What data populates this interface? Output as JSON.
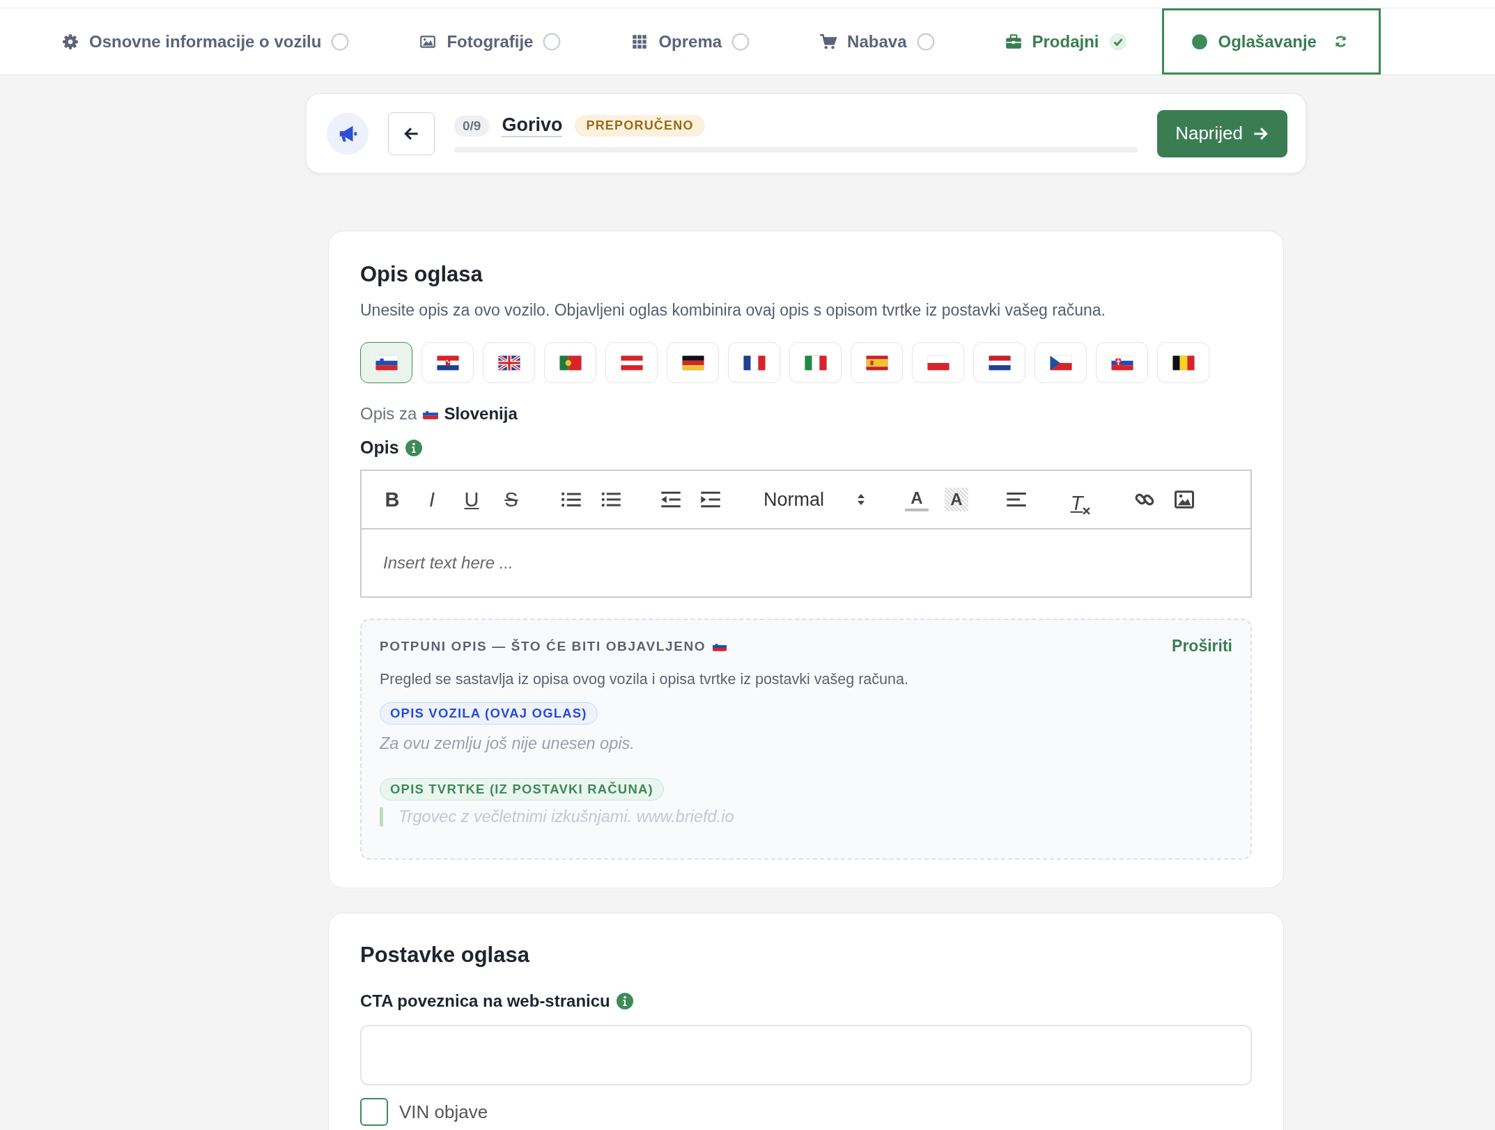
{
  "tabs": [
    {
      "label": "Osnovne informacije o vozilu",
      "done": false,
      "in_progress": false,
      "selected": false
    },
    {
      "label": "Fotografije",
      "done": false,
      "in_progress": false,
      "selected": false
    },
    {
      "label": "Oprema",
      "done": false,
      "in_progress": false,
      "selected": false
    },
    {
      "label": "Nabava",
      "done": false,
      "in_progress": false,
      "selected": false
    },
    {
      "label": "Prodajni",
      "done": true,
      "in_progress": false,
      "selected": false
    },
    {
      "label": "Oglašavanje",
      "done": false,
      "in_progress": true,
      "selected": true
    }
  ],
  "step": {
    "counter": "0/9",
    "title": "Gorivo",
    "badge": "PREPORUČENO",
    "progress": {
      "level": 0
    },
    "next_button": "Naprijed"
  },
  "description_card": {
    "title": "Opis oglasa",
    "subtitle": "Unesite opis za ovo vozilo. Objavljeni oglas kombinira ovaj opis s opisom tvrtke iz postavki vašeg računa.",
    "languages": [
      {
        "selected": true
      },
      {
        "selected": false
      },
      {
        "selected": false
      },
      {
        "selected": false
      },
      {
        "selected": false
      },
      {
        "selected": false
      },
      {
        "selected": false
      },
      {
        "selected": false
      },
      {
        "selected": false
      },
      {
        "selected": false
      },
      {
        "selected": false
      },
      {
        "selected": false
      },
      {
        "selected": false
      },
      {
        "selected": false
      }
    ],
    "current_language": {
      "prefix": "Opis za",
      "country": "Slovenija"
    },
    "field_label": "Opis",
    "editor": {
      "toolbar": {
        "groups": [
          {
            "items": [
              {
                "kind": "bold",
                "label": "B"
              },
              {
                "kind": "italic",
                "label": "I"
              },
              {
                "kind": "underline",
                "label": "U"
              },
              {
                "kind": "strike",
                "label": "S"
              }
            ]
          },
          {
            "items": [
              {
                "kind": "ordered"
              },
              {
                "kind": "bullet"
              }
            ]
          },
          {
            "items": [
              {
                "kind": "outdent"
              },
              {
                "kind": "indent"
              }
            ]
          },
          {
            "items": [
              {
                "kind": "header",
                "label": "Normal"
              }
            ]
          },
          {
            "items": [
              {
                "kind": "color",
                "label": "A"
              },
              {
                "kind": "background",
                "label": "A"
              }
            ]
          },
          {
            "items": [
              {
                "kind": "align"
              }
            ]
          },
          {
            "items": [
              {
                "kind": "clean",
                "label": "T"
              }
            ]
          },
          {
            "items": [
              {
                "kind": "link"
              },
              {
                "kind": "image"
              }
            ]
          }
        ]
      },
      "placeholder": "Insert text here ..."
    },
    "preview": {
      "heading": "POTPUNI OPIS — ŠTO ĆE BITI OBJAVLJENO",
      "expand_link": "Proširiti",
      "note": "Pregled se sastavlja iz opisa ovog vozila i opisa tvrtke iz postavki vašeg računa.",
      "sections": [
        {
          "kind": "vehicle",
          "tag": "OPIS VOZILA (OVAJ OGLAS)",
          "text": "Za ovu zemlju još nije unesen opis.",
          "empty": true
        },
        {
          "kind": "company",
          "tag": "OPIS TVRTKE (IZ POSTAVKI RAČUNA)",
          "text": "Trgovec z večletnimi izkušnjami. www.briefd.io"
        }
      ]
    }
  },
  "settings_card": {
    "title": "Postavke oglasa",
    "cta_label": "CTA poveznica na web-stranicu",
    "vin_checkbox": {
      "label": "VIN objave",
      "checked": false
    }
  }
}
